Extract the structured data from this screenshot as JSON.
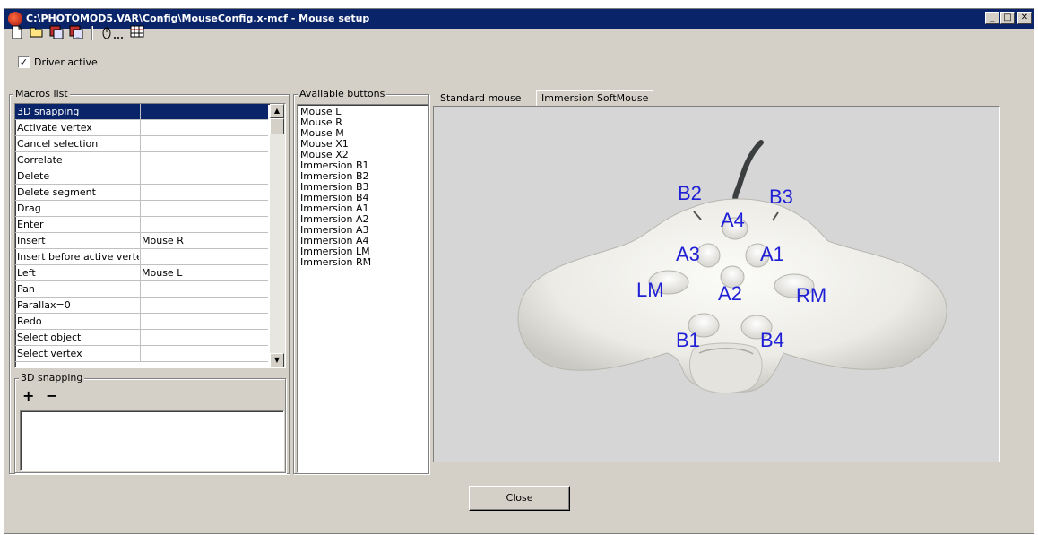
{
  "window": {
    "title": "C:\\PHOTOMOD5.VAR\\Config\\MouseConfig.x-mcf - Mouse setup",
    "min": "_",
    "max": "□",
    "close": "✕"
  },
  "toolbar": {
    "icons": [
      "new-file-icon",
      "open-folder-icon",
      "save-icon",
      "save-as-icon",
      "mouse-properties-icon",
      "grid-icon"
    ]
  },
  "driver": {
    "label": "Driver active",
    "checked": true,
    "check_mark": "✓"
  },
  "macros": {
    "title": "Macros list",
    "rows": [
      {
        "name": "3D snapping",
        "button": ""
      },
      {
        "name": "Activate vertex",
        "button": ""
      },
      {
        "name": "Cancel selection",
        "button": ""
      },
      {
        "name": "Correlate",
        "button": ""
      },
      {
        "name": "Delete",
        "button": ""
      },
      {
        "name": "Delete segment",
        "button": ""
      },
      {
        "name": "Drag",
        "button": ""
      },
      {
        "name": "Enter",
        "button": ""
      },
      {
        "name": "Insert",
        "button": "Mouse R"
      },
      {
        "name": "Insert before active vertex",
        "button": ""
      },
      {
        "name": "Left",
        "button": "Mouse L"
      },
      {
        "name": "Pan",
        "button": ""
      },
      {
        "name": "Parallax=0",
        "button": ""
      },
      {
        "name": "Redo",
        "button": ""
      },
      {
        "name": "Select object",
        "button": ""
      },
      {
        "name": "Select vertex",
        "button": ""
      }
    ],
    "selected_index": 0
  },
  "detail": {
    "title": "3D snapping",
    "add": "+",
    "remove": "−"
  },
  "available": {
    "title": "Available buttons",
    "items": [
      "Mouse L",
      "Mouse R",
      "Mouse M",
      "Mouse X1",
      "Mouse X2",
      "Immersion B1",
      "Immersion B2",
      "Immersion B3",
      "Immersion B4",
      "Immersion A1",
      "Immersion A2",
      "Immersion A3",
      "Immersion A4",
      "Immersion LM",
      "Immersion RM"
    ]
  },
  "tabs": [
    {
      "label": "Standard mouse",
      "active": false
    },
    {
      "label": "Immersion SoftMouse",
      "active": true
    }
  ],
  "mouse_labels": {
    "B2": "B2",
    "B3": "B3",
    "A4": "A4",
    "A3": "A3",
    "A1": "A1",
    "LM": "LM",
    "A2": "A2",
    "RM": "RM",
    "B1": "B1",
    "B4": "B4"
  },
  "close_label": "Close",
  "colors": {
    "titlebar": "#0a246a",
    "selection": "#0a246a",
    "dialog": "#d4d0c8",
    "label_blue": "#1f1fd6"
  }
}
